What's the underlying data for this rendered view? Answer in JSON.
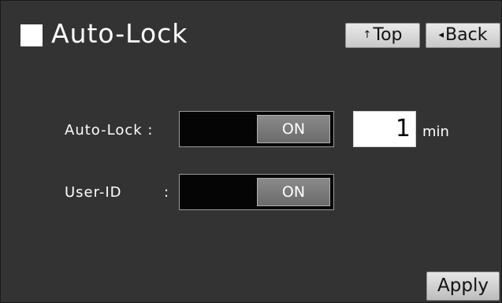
{
  "header": {
    "title": "Auto-Lock",
    "top_button": {
      "arrow": "↑",
      "label": "Top"
    },
    "back_button": {
      "arrow": "◂",
      "label": "Back"
    }
  },
  "settings": {
    "auto_lock": {
      "label": "Auto-Lock :",
      "toggle_state": "ON",
      "minutes_value": "1",
      "minutes_unit": "min"
    },
    "user_id": {
      "label": "User-ID",
      "colon": ":",
      "toggle_state": "ON"
    }
  },
  "footer": {
    "apply_label": "Apply"
  },
  "icons": {
    "title_marker": "square-icon",
    "top_arrow": "arrow-up-icon",
    "back_arrow": "triangle-left-icon"
  },
  "colors": {
    "background": "#333333",
    "toggle_track": "#050505",
    "toggle_knob": "#7a7a7a",
    "button_face": "#d9d9d9",
    "text": "#ffffff"
  }
}
